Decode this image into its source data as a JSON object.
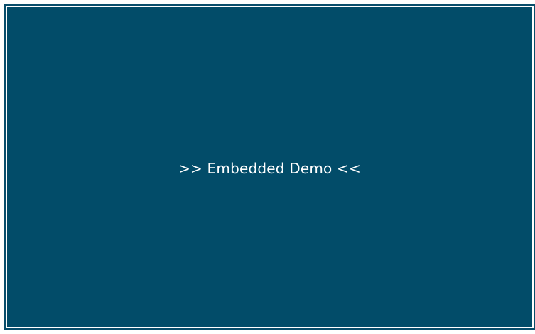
{
  "embedded_demo": {
    "label": ">> Embedded Demo <<"
  },
  "colors": {
    "panel_background": "#024c69",
    "frame_border": "#084d6b",
    "label_text": "#ffffff",
    "page_background": "#ffffff"
  }
}
